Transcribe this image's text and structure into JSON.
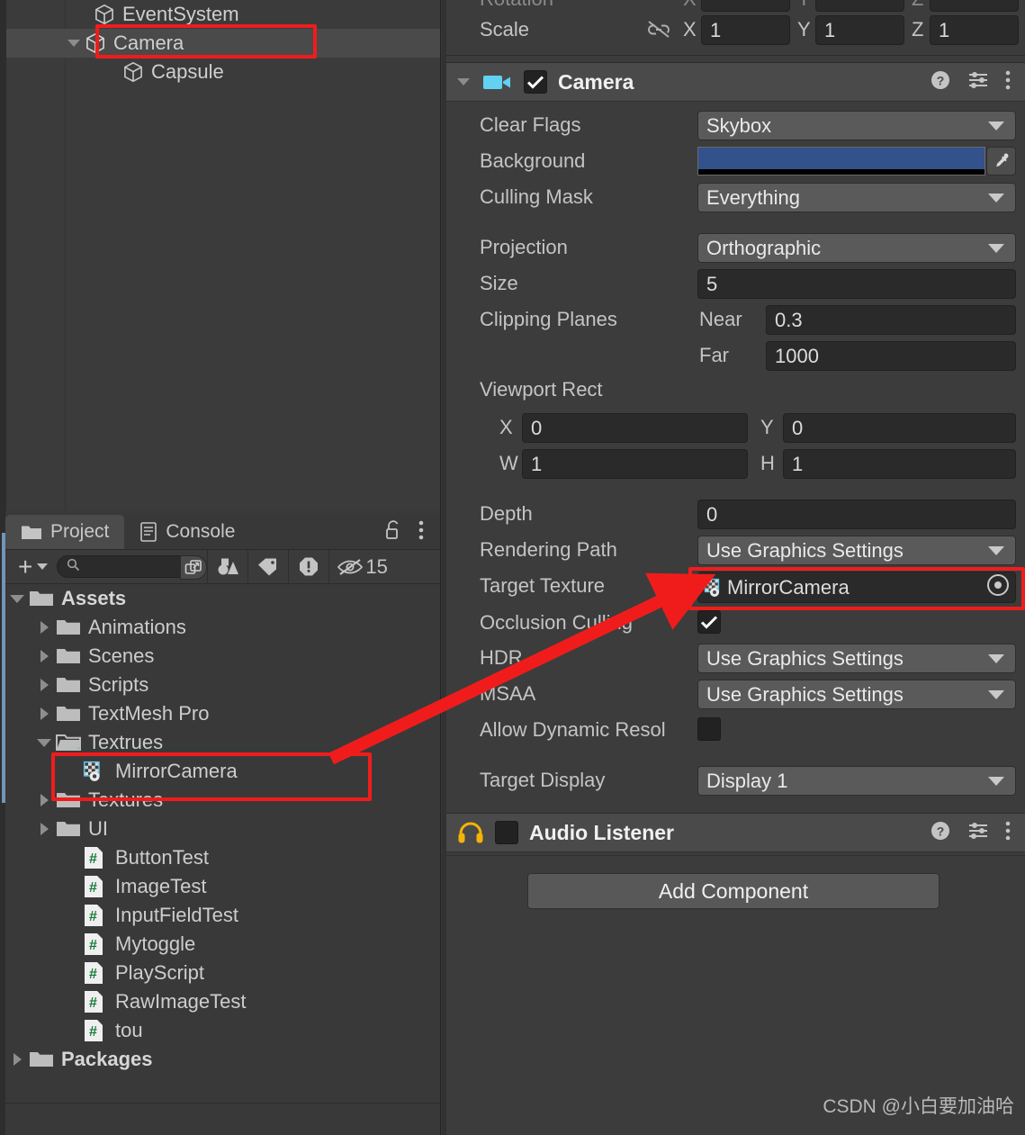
{
  "hierarchy": {
    "rows": [
      {
        "label": "EventSystem",
        "indent": 103,
        "expandable": false,
        "selected": false
      },
      {
        "label": "Camera",
        "indent": 103,
        "expandable": true,
        "selected": true
      },
      {
        "label": "Capsule",
        "indent": 135,
        "expandable": false,
        "selected": false
      }
    ]
  },
  "project": {
    "tabs": [
      {
        "label": "Project",
        "icon": "folder-icon",
        "active": true
      },
      {
        "label": "Console",
        "icon": "console-icon",
        "active": false
      }
    ],
    "lock_icon": "lock-open-icon",
    "menu_icon": "kebab-menu-icon",
    "toolbar": {
      "create_label": "+",
      "search_value": "",
      "search_placeholder": "",
      "hidden_count": "15"
    },
    "tree": [
      {
        "label": "Assets",
        "indent": 12,
        "kind": "folder",
        "arrow": "down",
        "bold": true
      },
      {
        "label": "Animations",
        "indent": 42,
        "kind": "folder",
        "arrow": "right",
        "bold": false
      },
      {
        "label": "Scenes",
        "indent": 42,
        "kind": "folder",
        "arrow": "right",
        "bold": false
      },
      {
        "label": "Scripts",
        "indent": 42,
        "kind": "folder",
        "arrow": "right",
        "bold": false
      },
      {
        "label": "TextMesh Pro",
        "indent": 42,
        "kind": "folder",
        "arrow": "right",
        "bold": false
      },
      {
        "label": "Textrues",
        "indent": 42,
        "kind": "folder-open",
        "arrow": "down",
        "bold": false
      },
      {
        "label": "MirrorCamera",
        "indent": 72,
        "kind": "rendertexture",
        "arrow": "none",
        "bold": false
      },
      {
        "label": "Textures",
        "indent": 42,
        "kind": "folder",
        "arrow": "right",
        "bold": false
      },
      {
        "label": "UI",
        "indent": 42,
        "kind": "folder",
        "arrow": "right",
        "bold": false
      },
      {
        "label": "ButtonTest",
        "indent": 72,
        "kind": "script",
        "arrow": "none",
        "bold": false
      },
      {
        "label": "ImageTest",
        "indent": 72,
        "kind": "script",
        "arrow": "none",
        "bold": false
      },
      {
        "label": "InputFieldTest",
        "indent": 72,
        "kind": "script",
        "arrow": "none",
        "bold": false
      },
      {
        "label": "Mytoggle",
        "indent": 72,
        "kind": "script",
        "arrow": "none",
        "bold": false
      },
      {
        "label": "PlayScript",
        "indent": 72,
        "kind": "script",
        "arrow": "none",
        "bold": false
      },
      {
        "label": "RawImageTest",
        "indent": 72,
        "kind": "script",
        "arrow": "none",
        "bold": false
      },
      {
        "label": "tou",
        "indent": 72,
        "kind": "script",
        "arrow": "none",
        "bold": false
      },
      {
        "label": "Packages",
        "indent": 12,
        "kind": "folder",
        "arrow": "right",
        "bold": true
      }
    ]
  },
  "inspector": {
    "transform": {
      "scale_label": "Scale",
      "link_icon": "link-off-icon",
      "x_label": "X",
      "x_value": "1",
      "y_label": "Y",
      "y_value": "1",
      "z_label": "Z",
      "z_value": "1"
    },
    "camera_component": {
      "title": "Camera",
      "icon": "camera-icon",
      "enabled": true,
      "help_icon": "help-icon",
      "preset_icon": "preset-icon",
      "menu_icon": "kebab-menu-icon",
      "fields": {
        "clear_flags_label": "Clear Flags",
        "clear_flags_value": "Skybox",
        "background_label": "Background",
        "background_color": "#33518B",
        "eyedropper_icon": "eyedropper-icon",
        "culling_mask_label": "Culling Mask",
        "culling_mask_value": "Everything",
        "projection_label": "Projection",
        "projection_value": "Orthographic",
        "size_label": "Size",
        "size_value": "5",
        "clipping_label": "Clipping Planes",
        "near_label": "Near",
        "near_value": "0.3",
        "far_label": "Far",
        "far_value": "1000",
        "viewport_label": "Viewport Rect",
        "vp_x_label": "X",
        "vp_x_value": "0",
        "vp_y_label": "Y",
        "vp_y_value": "0",
        "vp_w_label": "W",
        "vp_w_value": "1",
        "vp_h_label": "H",
        "vp_h_value": "1",
        "depth_label": "Depth",
        "depth_value": "0",
        "rendering_path_label": "Rendering Path",
        "rendering_path_value": "Use Graphics Settings",
        "target_texture_label": "Target Texture",
        "target_texture_value": "MirrorCamera",
        "target_texture_icon": "rendertexture-icon",
        "object_picker_icon": "object-picker-icon",
        "occlusion_label": "Occlusion Culling",
        "occlusion_checked": true,
        "hdr_label": "HDR",
        "hdr_value": "Use Graphics Settings",
        "msaa_label": "MSAA",
        "msaa_value": "Use Graphics Settings",
        "dynres_label": "Allow Dynamic Resol",
        "dynres_checked": false,
        "target_display_label": "Target Display",
        "target_display_value": "Display 1"
      }
    },
    "audio_listener": {
      "title": "Audio Listener",
      "icon": "headphones-icon",
      "enabled": false,
      "help_icon": "help-icon",
      "preset_icon": "preset-icon",
      "menu_icon": "kebab-menu-icon"
    },
    "add_component_label": "Add Component"
  },
  "annotations": {
    "highlight_color": "#F01C1C",
    "arrow_from": "MirrorCamera asset in Project",
    "arrow_to": "Target Texture field"
  },
  "watermark": "CSDN @小白要加油哈"
}
